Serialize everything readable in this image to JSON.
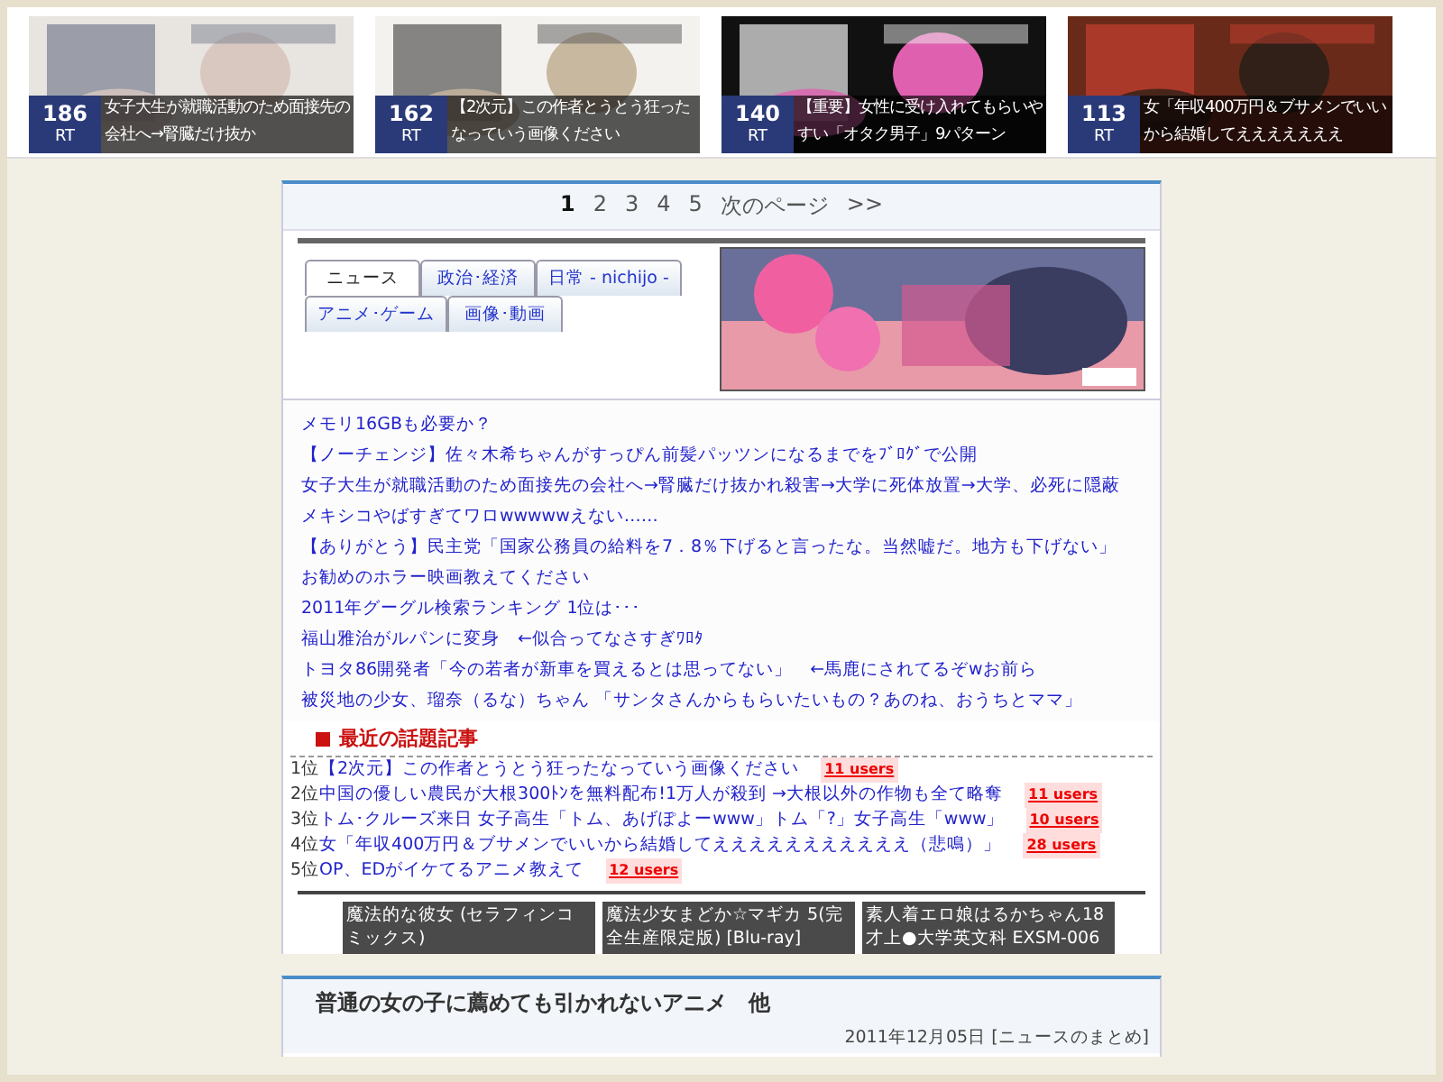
{
  "thumbnails": [
    {
      "count": "186",
      "rt": "RT",
      "caption": "女子大生が就職活動のため面接先の会社へ→腎臓だけ抜か"
    },
    {
      "count": "162",
      "rt": "RT",
      "caption": "【2次元】この作者とうとう狂ったなっていう画像ください"
    },
    {
      "count": "140",
      "rt": "RT",
      "caption": "【重要】女性に受け入れてもらいやすい「オタク男子」9パターン"
    },
    {
      "count": "113",
      "rt": "RT",
      "caption": "女「年収400万円＆ブサメンでいいから結婚してえええええええ"
    }
  ],
  "pager": {
    "pages": [
      {
        "label": "1",
        "selected": true
      },
      {
        "label": "2",
        "selected": false
      },
      {
        "label": "3",
        "selected": false
      },
      {
        "label": "4",
        "selected": false
      },
      {
        "label": "5",
        "selected": false
      }
    ],
    "next": "次のページ",
    "last": ">>"
  },
  "tabs": [
    {
      "label": "ニュース",
      "selected": true
    },
    {
      "label": "政治･経済",
      "selected": false
    },
    {
      "label": "日常 - nichijo -",
      "selected": false
    },
    {
      "label": "アニメ･ゲーム",
      "selected": false
    },
    {
      "label": "画像･動画",
      "selected": false
    }
  ],
  "headlines": [
    "メモリ16GBも必要か？",
    "【ノーチェンジ】佐々木希ちゃんがすっぴん前髪パッツンになるまでをﾌﾞﾛｸﾞで公開",
    "女子大生が就職活動のため面接先の会社へ→腎臓だけ抜かれ殺害→大学に死体放置→大学、必死に隠蔽",
    "メキシコやばすぎてワロwwwwwえない……",
    "【ありがとう】民主党「国家公務員の給料を7．8％下げると言ったな。当然嘘だ。地方も下げない」",
    "お勧めのホラー映画教えてください",
    "2011年グーグル検索ランキング 1位は･･･",
    "福山雅治がルパンに変身　←似合ってなさすぎﾜﾛﾀ",
    "トヨタ86開発者「今の若者が新車を買えるとは思ってない」　←馬鹿にされてるぞwお前ら",
    "被災地の少女、瑠奈（るな）ちゃん 「サンタさんからもらいたいもの？あのね、おうちとママ」"
  ],
  "ranking": {
    "title": "最近の話題記事",
    "items": [
      {
        "rank": "1位",
        "title": "【2次元】この作者とうとう狂ったなっていう画像ください",
        "users": "11 users"
      },
      {
        "rank": "2位",
        "title": "中国の優しい農民が大根300ﾄﾝを無料配布!1万人が殺到 →大根以外の作物も全て略奪",
        "users": "11 users"
      },
      {
        "rank": "3位",
        "title": "トム･クルーズ来日 女子高生「トム、あげぽよーwww」トム「?」女子高生「www」",
        "users": "10 users"
      },
      {
        "rank": "4位",
        "title": "女「年収400万円＆ブサメンでいいから結婚してえええええええええええ（悲鳴）」",
        "users": "28 users"
      },
      {
        "rank": "5位",
        "title": "OP、EDがイケてるアニメ教えて",
        "users": "12 users"
      }
    ]
  },
  "products": [
    "魔法的な彼女 (セラフィンコミックス)",
    "魔法少女まどか☆マギカ 5(完全生産限定版) [Blu-ray]",
    "素人着エロ娘はるかちゃん18才上●大学英文科 EXSM-006"
  ],
  "article": {
    "title": "普通の女の子に薦めても引かれないアニメ　他",
    "date": "2011年12月05日 [ニュースのまとめ]"
  }
}
